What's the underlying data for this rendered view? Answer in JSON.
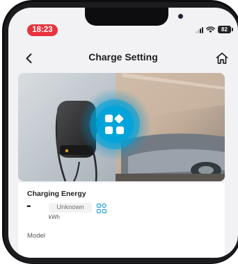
{
  "status_bar": {
    "time": "18:23",
    "battery": "82"
  },
  "nav": {
    "title": "Charge Setting"
  },
  "charging_energy": {
    "label": "Charging Energy",
    "value": "-",
    "status": "Unknown",
    "unit": "kWh"
  },
  "model": {
    "label": "Model"
  },
  "colors": {
    "accent": "#00a3d9",
    "time_pill": "#e8343d",
    "text": "#1c1c1c"
  },
  "icons": {
    "back": "chevron-left-icon",
    "home": "home-icon",
    "scene": "dashboard-grid-icon",
    "energy": "dashboard-grid-icon"
  }
}
